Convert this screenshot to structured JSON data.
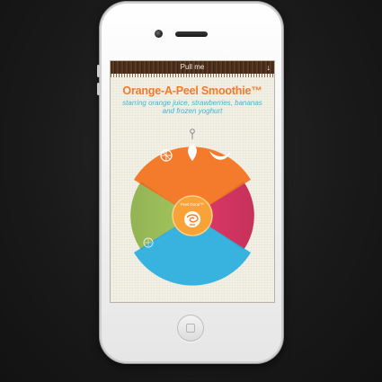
{
  "pull_bar": {
    "label": "Pull me",
    "arrow_icon": "arrow-down-icon"
  },
  "smoothie": {
    "title": "Orange-A-Peel Smoothie™",
    "description": "starring orange juice, strawberries, bananas and frozen yoghurt"
  },
  "wheel": {
    "center_label": "Peel Good™",
    "segments": [
      {
        "name": "orange",
        "color": "#f47b2b"
      },
      {
        "name": "pink",
        "color": "#e03867"
      },
      {
        "name": "blue",
        "color": "#38b2de"
      },
      {
        "name": "green",
        "color": "#a3c75e"
      }
    ],
    "icons": [
      "orange-slice-icon",
      "strawberry-icon",
      "banana-icon",
      "pointer-pin-icon",
      "lime-slice-icon",
      "swirl-icon"
    ]
  },
  "colors": {
    "accent": "#f07a2a",
    "subtitle": "#3fb6d6",
    "pull_bar": "#4a2e1c"
  }
}
